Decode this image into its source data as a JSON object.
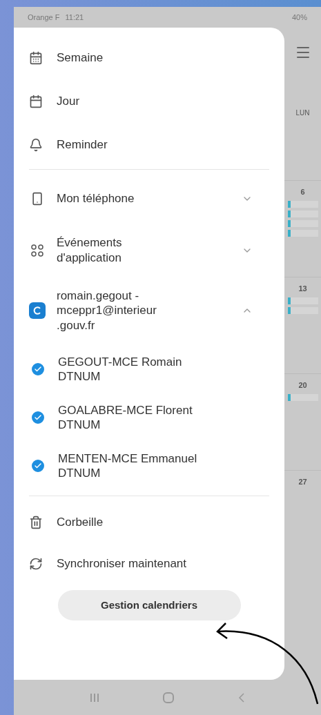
{
  "status_bar": {
    "carrier": "Orange F",
    "time": "11:21",
    "battery": "40%"
  },
  "drawer": {
    "views": [
      {
        "kind": "week",
        "label": "Semaine"
      },
      {
        "kind": "day",
        "label": "Jour"
      },
      {
        "kind": "reminder",
        "label": "Reminder"
      }
    ],
    "sources": [
      {
        "kind": "phone",
        "label": "Mon téléphone",
        "expanded": false
      },
      {
        "kind": "apps",
        "label": "Événements d'application",
        "expanded": false
      },
      {
        "kind": "account",
        "label": "romain.gegout -mceppr1@interieur .gouv.fr",
        "expanded": true
      }
    ],
    "calendars": [
      {
        "name": "GEGOUT-MCE Romain DTNUM",
        "color": "#1e8fe0",
        "checked": true
      },
      {
        "name": "GOALABRE-MCE Florent DTNUM",
        "color": "#1e8fe0",
        "checked": true
      },
      {
        "name": "MENTEN-MCE Emmanuel DTNUM",
        "color": "#1e8fe0",
        "checked": true
      }
    ],
    "actions": [
      {
        "kind": "trash",
        "label": "Corbeille"
      },
      {
        "kind": "sync",
        "label": "Synchroniser maintenant"
      }
    ],
    "manage_button": "Gestion calendriers"
  },
  "calendar": {
    "day_header": "LUN",
    "weeks": [
      {
        "day": "6"
      },
      {
        "day": "13"
      },
      {
        "day": "20"
      },
      {
        "day": "27"
      }
    ]
  }
}
